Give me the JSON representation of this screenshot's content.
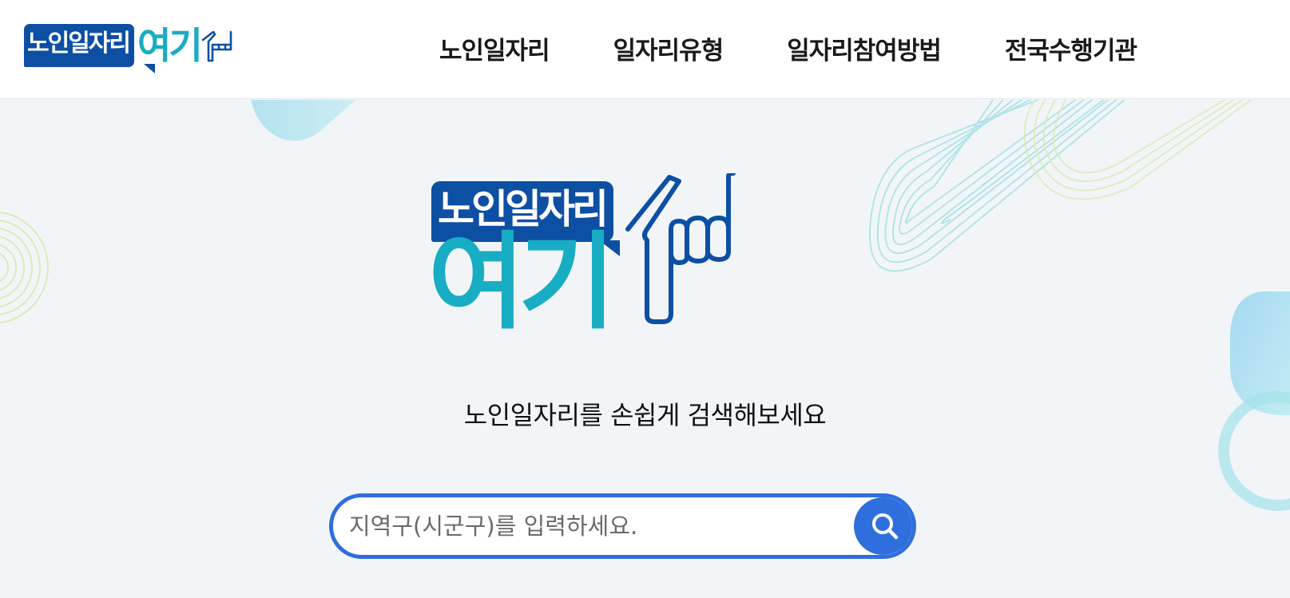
{
  "header": {
    "logo": {
      "badge_text": "노인일자리",
      "accent_text": "여기"
    },
    "nav": [
      {
        "label": "노인일자리"
      },
      {
        "label": "일자리유형"
      },
      {
        "label": "일자리참여방법"
      },
      {
        "label": "전국수행기관"
      }
    ]
  },
  "hero": {
    "logo": {
      "badge_text": "노인일자리",
      "accent_text": "여기"
    },
    "subtitle": "노인일자리를 손쉽게 검색해보세요",
    "search": {
      "placeholder": "지역구(시군구)를 입력하세요.",
      "value": "",
      "icon": "search-icon"
    }
  },
  "colors": {
    "brand_navy": "#0d4fa3",
    "brand_teal": "#18adc3",
    "search_blue": "#2f6fdd",
    "background": "#f2f5f8"
  },
  "icons": [
    "pointing-hand-icon",
    "search-icon"
  ]
}
